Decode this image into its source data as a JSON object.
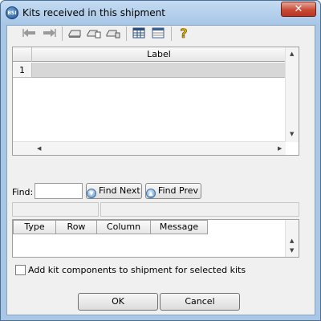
{
  "window": {
    "title": "Kits received in this shipment",
    "app_icon_text": "BSI",
    "close_glyph": "✕"
  },
  "toolbar": {
    "icons": [
      "back-icon",
      "forward-icon",
      "print-icon",
      "print-preview-icon",
      "print-setup-icon",
      "table-icon",
      "table-layout-icon",
      "help-icon"
    ]
  },
  "grid": {
    "column_label": "Label",
    "rows": [
      {
        "number": "1",
        "label": ""
      }
    ]
  },
  "find": {
    "label": "Find:",
    "value": "",
    "find_next": "Find Next",
    "find_prev": "Find Prev"
  },
  "messages": {
    "columns": [
      "Type",
      "Row",
      "Column",
      "Message"
    ]
  },
  "options": {
    "add_components_label": "Add kit components to shipment for selected kits",
    "add_components_checked": false
  },
  "buttons": {
    "ok": "OK",
    "cancel": "Cancel"
  }
}
